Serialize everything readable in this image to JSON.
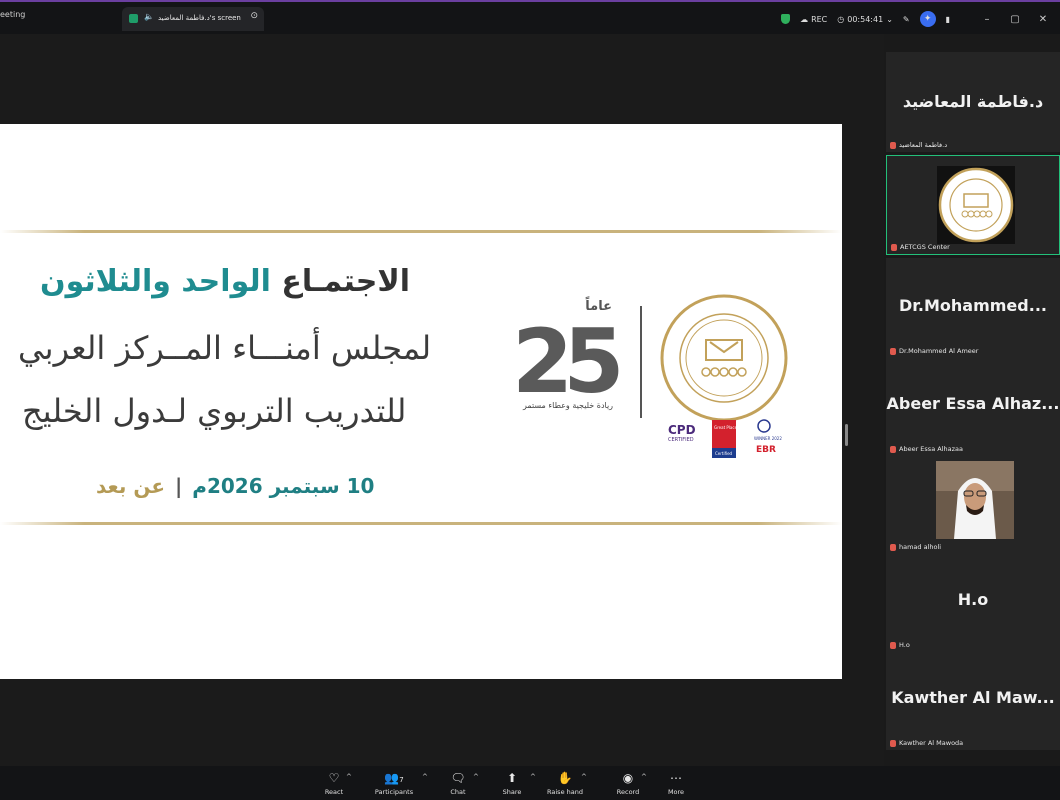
{
  "window": {
    "left_tab_label": "eeting",
    "active_tab_label": "د.فاطمة المعاضيد's screen",
    "rec_label": "REC",
    "timer": "00:54:41"
  },
  "slide": {
    "title_part1": "الاجتمـاع",
    "title_highlight": "الواحد والثلاثون",
    "line2": "لمجلس أمنـــاء المــركز العربي",
    "line3": "للتدريب التربوي لـدول الخليج",
    "date": "10 سبتمبر 2026م",
    "separator": "|",
    "remote": "عن بعد",
    "anniversary_number": "25",
    "anniversary_word": "عاماً",
    "anniversary_tagline": "ريادة خليجية وعطاء مستمر",
    "badge_cpd": "CPD",
    "badge_cpd_sub": "CERTIFIED",
    "badge_gptw": "Great Place To Work.",
    "badge_gptw_sub": "Certified",
    "badge_winner": "WINNER 2022",
    "badge_ebr": "EBR",
    "seal_text": "المركز العربي للتدريب التربوي لدول الخليج"
  },
  "participants": [
    {
      "display": "د.فاطمة المعاضيد",
      "tag": "د.فاطمة المعاضيد",
      "video": false,
      "active": false
    },
    {
      "display": "",
      "tag": "AETCGS Center",
      "video": true,
      "active": true
    },
    {
      "display": "Dr.Mohammed...",
      "tag": "Dr.Mohammed Al Ameer",
      "video": false,
      "active": false
    },
    {
      "display": "Abeer Essa Alhaz...",
      "tag": "Abeer Essa Alhazaa",
      "video": false,
      "active": false
    },
    {
      "display": "",
      "tag": "hamad alholi",
      "video": true,
      "active": false
    },
    {
      "display": "H.o",
      "tag": "H.o",
      "video": false,
      "active": false
    },
    {
      "display": "Kawther Al Maw...",
      "tag": "Kawther Al Mawoda",
      "video": false,
      "active": false
    }
  ],
  "toolbar": {
    "react": "React",
    "participants": "Participants",
    "participants_count": "7",
    "chat": "Chat",
    "share": "Share",
    "raise_hand": "Raise hand",
    "record": "Record",
    "more": "More"
  },
  "colors": {
    "teal": "#1f8c90",
    "gold": "#b49a55",
    "active_border": "#23c07a",
    "muted_mic": "#e05a4e"
  }
}
